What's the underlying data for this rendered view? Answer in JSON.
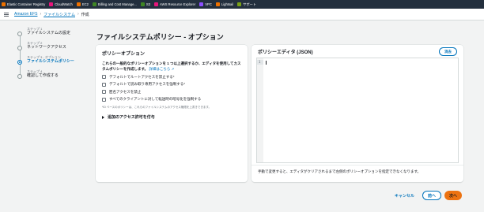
{
  "favorites": [
    {
      "label": "Elastic Container Registry",
      "color": "#ed7100",
      "icon": "ecr-icon"
    },
    {
      "label": "CloudWatch",
      "color": "#e7157b",
      "icon": "cloudwatch-icon"
    },
    {
      "label": "EC2",
      "color": "#ed7100",
      "icon": "ec2-icon"
    },
    {
      "label": "Billing and Cost Manage...",
      "color": "#3f8624",
      "icon": "billing-icon"
    },
    {
      "label": "S3",
      "color": "#3f8624",
      "icon": "s3-icon"
    },
    {
      "label": "AWS Resource Explorer",
      "color": "#e7157b",
      "icon": "resource-explorer-icon"
    },
    {
      "label": "VPC",
      "color": "#8c4fff",
      "icon": "vpc-icon"
    },
    {
      "label": "Lightsail",
      "color": "#ed7100",
      "icon": "lightsail-icon"
    },
    {
      "label": "サポート",
      "color": "#7aa116",
      "icon": "support-icon"
    }
  ],
  "breadcrumb": {
    "items": [
      "Amazon EFS",
      "ファイルシステム",
      "作成"
    ]
  },
  "steps": [
    {
      "num": "ステップ 1",
      "name": "ファイルシステムの設定"
    },
    {
      "num": "ステップ 2",
      "name": "ネットワークアクセス"
    },
    {
      "num": "ステップ 3 - オプション",
      "name": "ファイルシステムポリシー"
    },
    {
      "num": "ステップ 4",
      "name": "確認して作成する"
    }
  ],
  "page_title": "ファイルシステムポリシー - オプション",
  "policy_options": {
    "title": "ポリシーオプション",
    "description": "これらの一般的なポリシーオプションを 1 つ以上選択するか、エディタを使用してカスタムポリシーを作成します。",
    "details_link": "詳細はこちら",
    "checkboxes": [
      {
        "label": "デフォルトでルートアクセスを禁止する*",
        "checked": false
      },
      {
        "label": "デフォルトで読み取り専用アクセスを強制する*",
        "checked": false
      },
      {
        "label": "匿名アクセスを禁止",
        "checked": false
      },
      {
        "label": "すべてのクライアントに対して転送時の暗号化を強制する",
        "checked": false
      }
    ],
    "note": "*ID ベースのポリシーは、これらのファイルシステムのアクセス権限を上書きできます。",
    "expander": "追加のアクセス許可を付与"
  },
  "editor": {
    "title": "ポリシーエディタ (JSON)",
    "clear_label": "消去",
    "line_number": "1",
    "footer": "手動で変更すると、エディタがクリアされるまで左側のポリシーオプションを指定できなくなります。"
  },
  "actions": {
    "cancel": "キャンセル",
    "previous": "前へ",
    "next": "次へ"
  },
  "colors": {
    "accent": "#0073bb",
    "primary_button": "#ec7211",
    "topbar": "#232f3e"
  }
}
